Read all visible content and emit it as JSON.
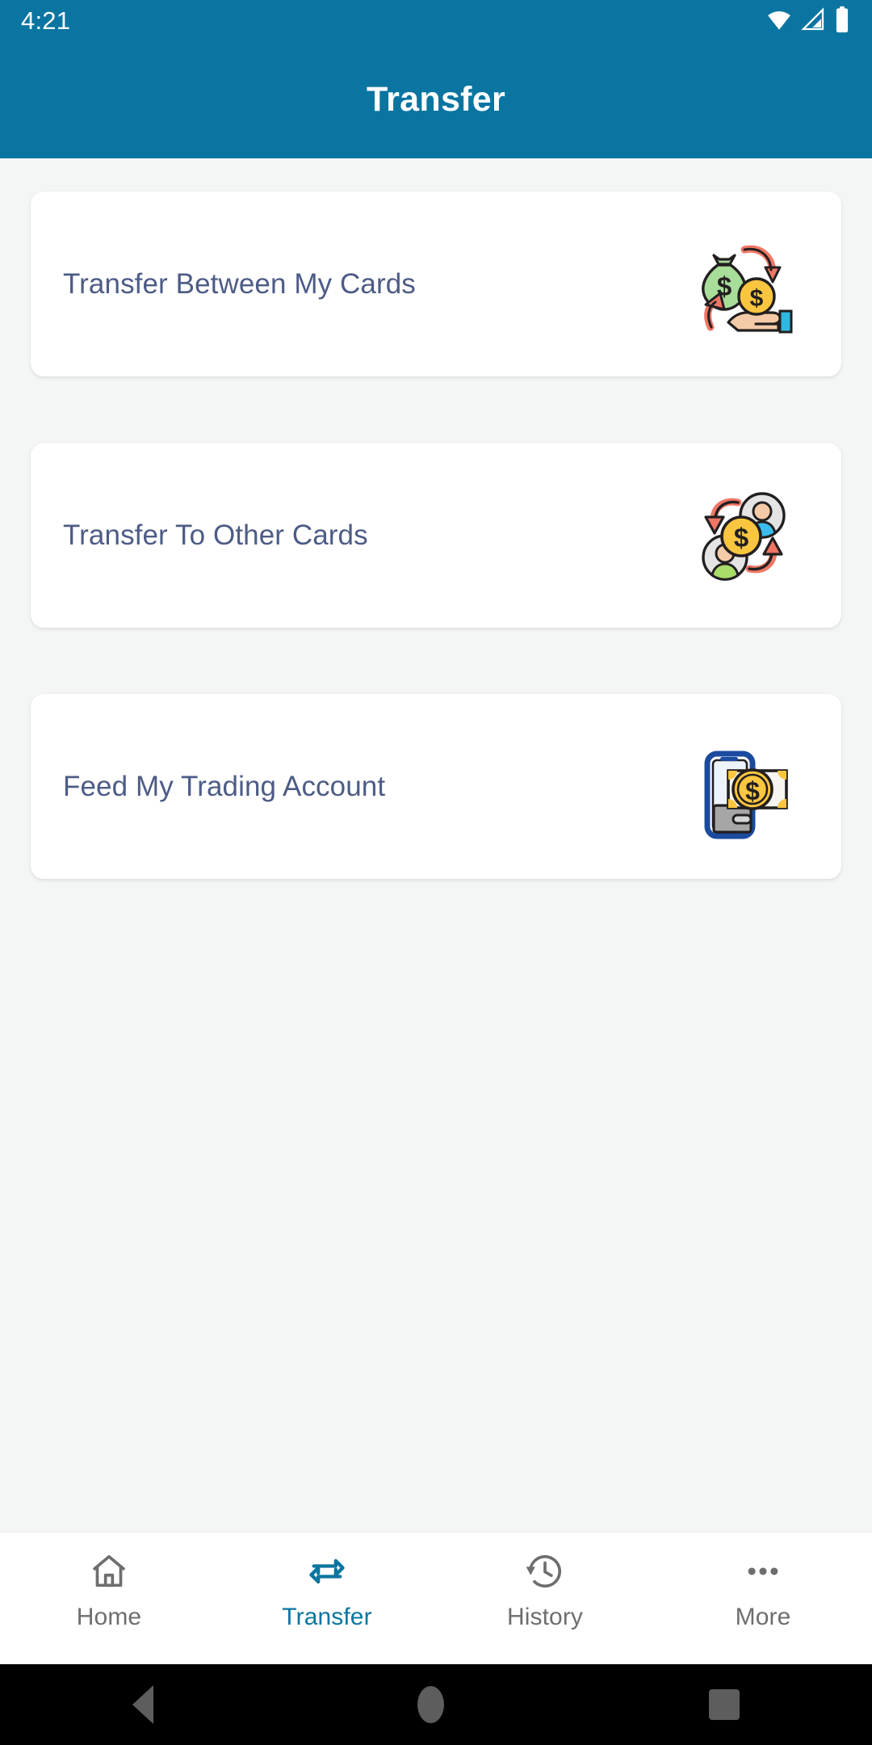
{
  "status_bar": {
    "time": "4:21",
    "icons": [
      "wifi-icon",
      "cellular-signal-icon",
      "battery-icon"
    ]
  },
  "header": {
    "title": "Transfer",
    "background_color": "#0a75a0",
    "title_color": "#ffffff"
  },
  "content": {
    "background_color": "#f4f5f5",
    "cards": [
      {
        "label": "Transfer Between My Cards",
        "icon": "money-bag-to-hand-coin-icon",
        "label_color": "#4d5c86"
      },
      {
        "label": "Transfer To Other Cards",
        "icon": "people-exchange-coin-icon",
        "label_color": "#4d5c86"
      },
      {
        "label": "Feed My Trading Account",
        "icon": "phone-wallet-banknote-coin-icon",
        "label_color": "#4d5c86"
      }
    ]
  },
  "bottom_nav": {
    "active_color": "#0a75a0",
    "inactive_color": "#6e6e6e",
    "items": [
      {
        "label": "Home",
        "icon": "home-icon",
        "active": false
      },
      {
        "label": "Transfer",
        "icon": "transfer-icon",
        "active": true
      },
      {
        "label": "History",
        "icon": "history-icon",
        "active": false
      },
      {
        "label": "More",
        "icon": "more-icon",
        "active": false
      }
    ]
  },
  "android_nav": {
    "buttons": [
      "back-button",
      "home-button",
      "recents-button"
    ]
  }
}
